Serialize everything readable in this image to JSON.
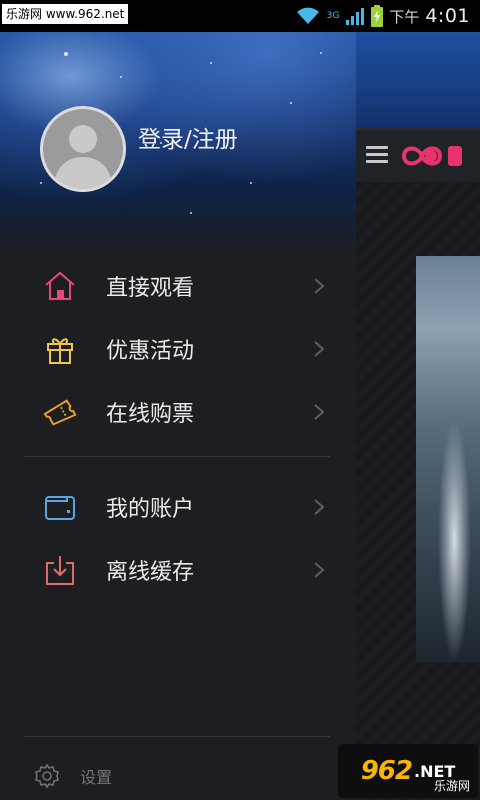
{
  "statusbar": {
    "watermark": "乐游网 www.962.net",
    "time_prefix": "下午",
    "time": "4:01",
    "network_label": "3G",
    "icons": [
      "wifi-icon",
      "signal-icon",
      "battery-icon"
    ]
  },
  "drawer": {
    "login_label": "登录/注册",
    "menu": [
      {
        "label": "直接观看",
        "icon": "home-icon",
        "color": "#e8457a"
      },
      {
        "label": "优惠活动",
        "icon": "gift-icon",
        "color": "#f0c64a"
      },
      {
        "label": "在线购票",
        "icon": "ticket-icon",
        "color": "#f0a324"
      },
      {
        "label": "我的账户",
        "icon": "wallet-icon",
        "color": "#5aa7e0"
      },
      {
        "label": "离线缓存",
        "icon": "download-icon",
        "color": "#e06a6a"
      }
    ],
    "settings_label": "设置"
  },
  "watermark_bottom": {
    "number": "962",
    "suffix": ".NET",
    "sub": "乐游网"
  },
  "colors": {
    "drawer_bg": "#1c1e21",
    "brand": "#e8336d"
  }
}
